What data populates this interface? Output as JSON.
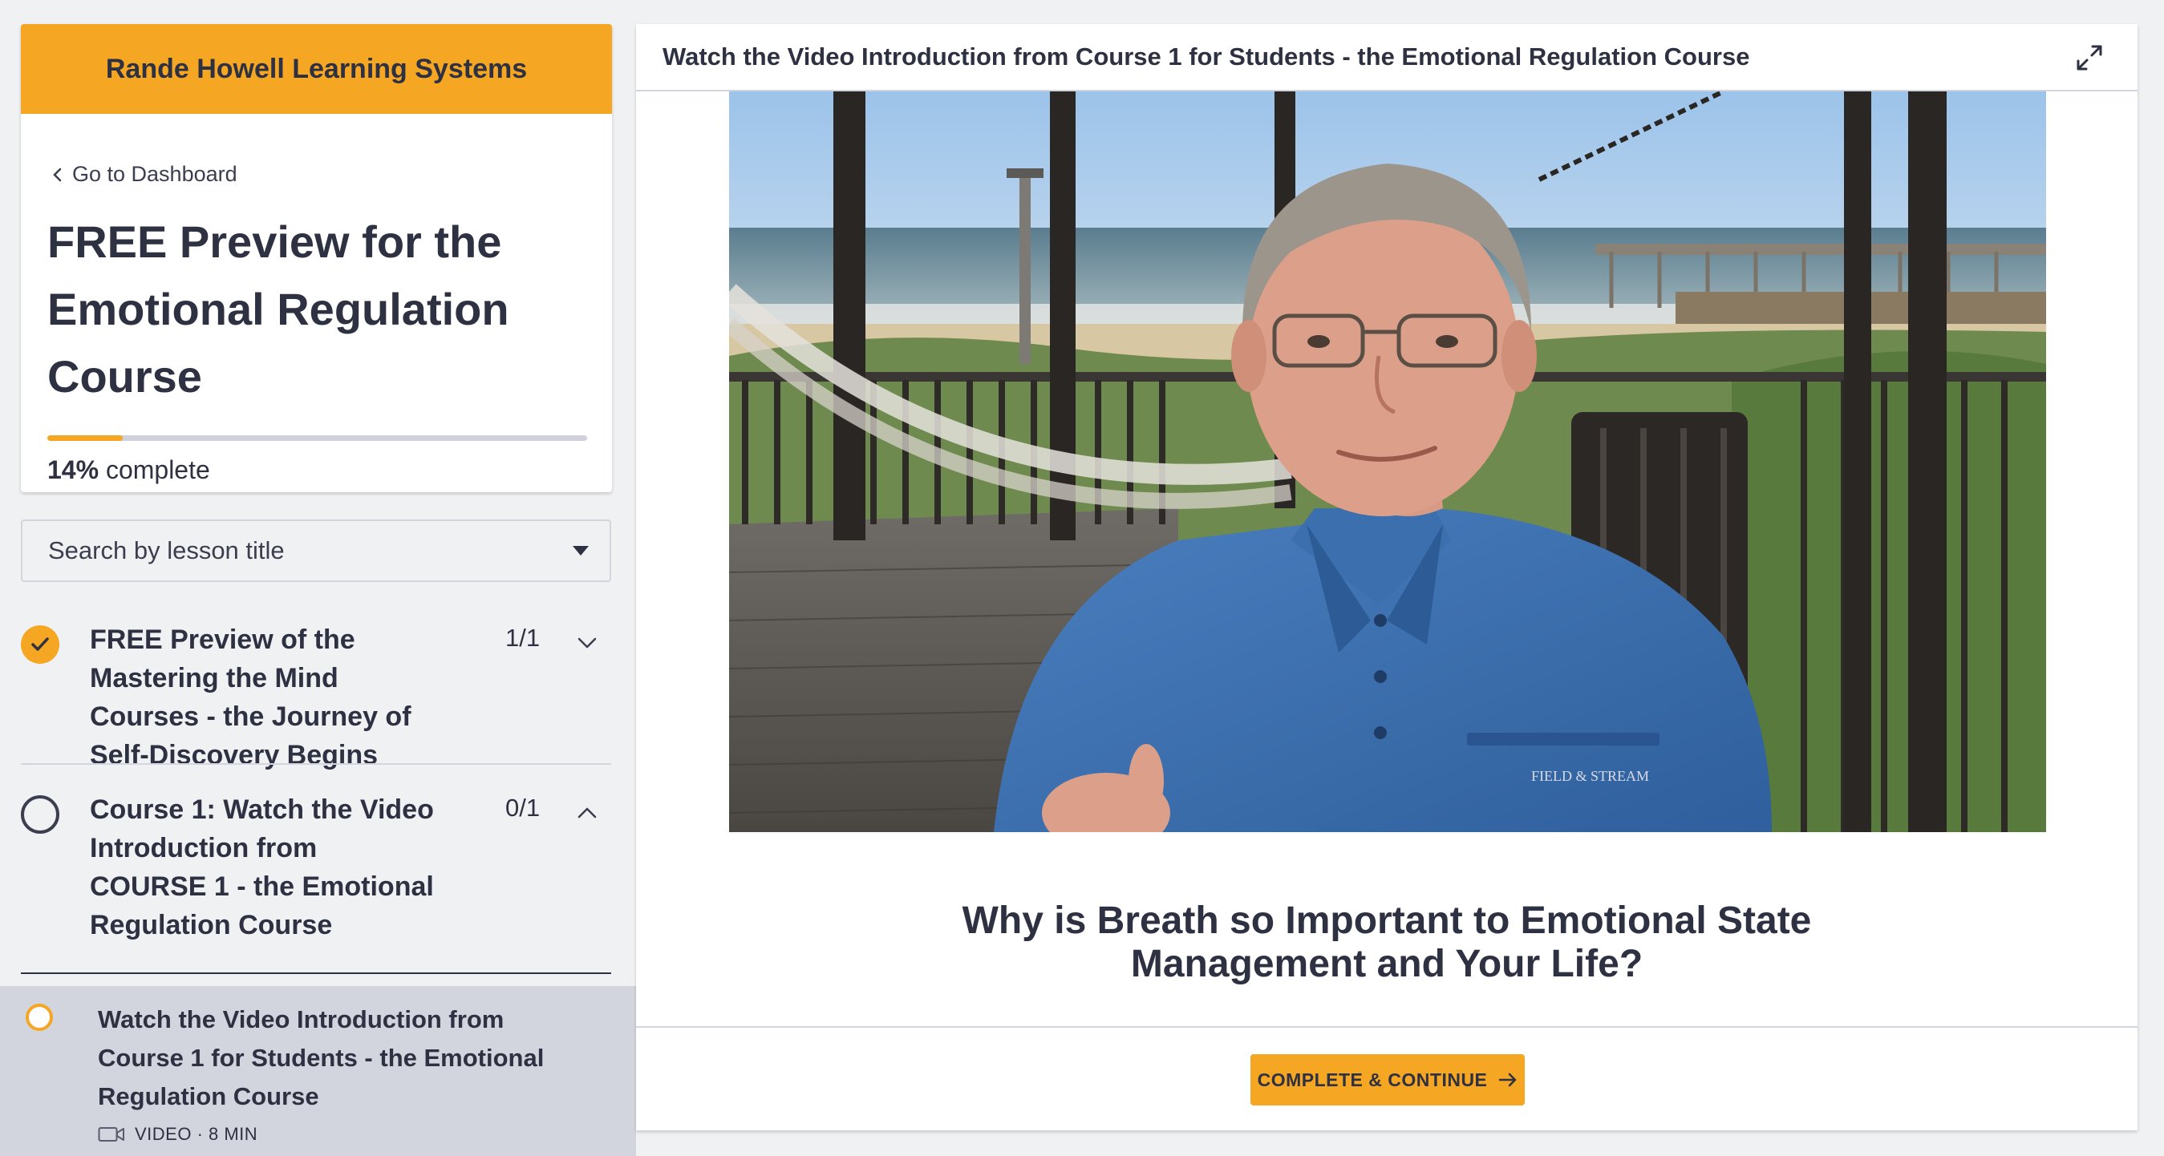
{
  "sidebar": {
    "school_name": "Rande Howell Learning Systems",
    "dashboard_link": "Go to Dashboard",
    "course_title": "FREE Preview for the Emotional Regulation Course",
    "progress": {
      "percent": 14,
      "percent_label": "14%",
      "suffix": "complete"
    },
    "search": {
      "placeholder": "Search by lesson title"
    },
    "chapters": [
      {
        "title": "FREE Preview of the Mastering the Mind Courses - the Journey of Self-Discovery Begins",
        "count": "1/1",
        "status": "complete",
        "expanded": false
      },
      {
        "title": "Course 1: Watch the Video Introduction from COURSE 1 - the Emotional Regulation Course",
        "count": "0/1",
        "status": "incomplete",
        "expanded": true
      }
    ],
    "active_lesson": {
      "title": "Watch the Video Introduction from Course 1 for Students - the Emotional Regulation Course",
      "meta": "VIDEO · 8 MIN",
      "icon": "video-camera-icon"
    }
  },
  "main": {
    "lesson_title": "Watch the Video Introduction from Course 1 for Students - the Emotional Regulation Course",
    "video_caption_heading": "Why is Breath so Important to Emotional State Management and Your Life?",
    "video_shirt_text": "FIELD & STREAM",
    "complete_button": "COMPLETE & CONTINUE"
  },
  "colors": {
    "accent": "#f5a623",
    "text": "#2e3142",
    "panel_bg": "#f0f1f3",
    "active_row": "#d3d5de"
  }
}
